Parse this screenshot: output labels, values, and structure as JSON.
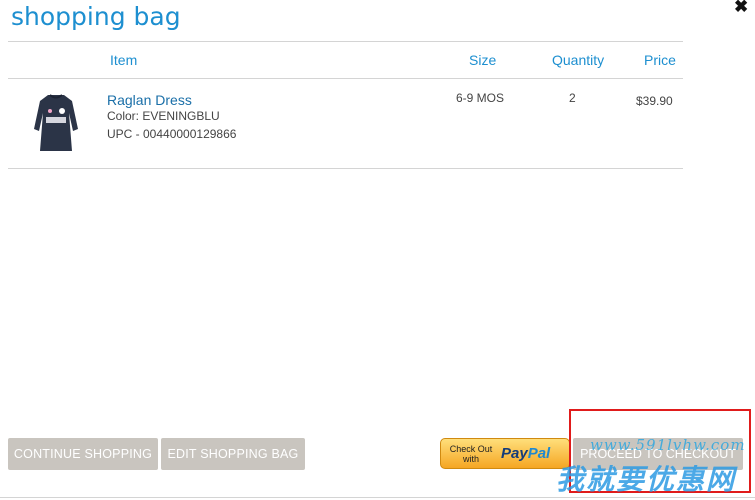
{
  "header": {
    "title": "shopping bag"
  },
  "table": {
    "columns": {
      "item": "Item",
      "size": "Size",
      "quantity": "Quantity",
      "price": "Price"
    },
    "rows": [
      {
        "name": "Raglan Dress",
        "color": "Color: EVENINGBLU",
        "upc": "UPC  - 00440000129866",
        "size": "6-9 MOS",
        "quantity": "2",
        "price": "$39.90"
      }
    ]
  },
  "buttons": {
    "continue": "CONTINUE SHOPPING",
    "edit": "EDIT SHOPPING BAG",
    "paypal_small": "Check Out with",
    "paypal_brand_a": "Pay",
    "paypal_brand_b": "Pal",
    "checkout": "PROCEED TO CHECKOUT"
  },
  "watermark": {
    "url": "www.591lvhw.com",
    "text": "我就要优惠网"
  },
  "colors": {
    "accent": "#1d8fd0",
    "button_gray": "#c9c5bf",
    "highlight": "#e01b1b"
  }
}
